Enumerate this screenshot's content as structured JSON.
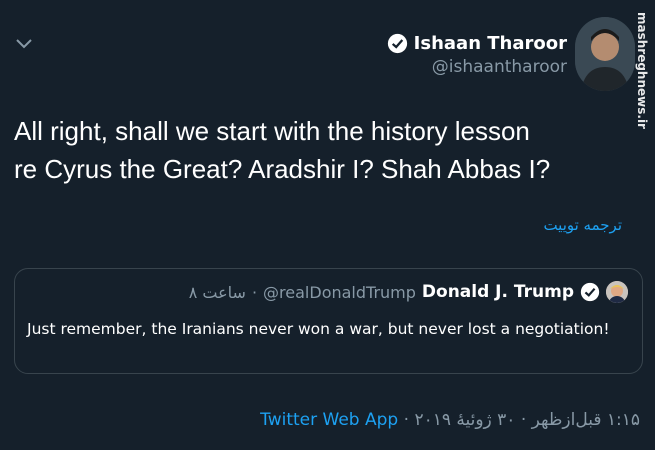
{
  "author": {
    "name": "Ishaan Tharoor",
    "handle": "@ishaantharoor"
  },
  "watermark": "mashreghnews.ir",
  "tweet": {
    "line1": "All right, shall we start with the history lesson",
    "line2": "re Cyrus the Great? Aradshir I? Shah Abbas I?"
  },
  "translate_label": "ترجمه توییت",
  "quoted": {
    "name": "Donald J. Trump",
    "handle": "@realDonaldTrump",
    "separator": "·",
    "time": "۸ ساعت",
    "text": "Just remember, the Iranians never won a war, but never lost a negotiation!"
  },
  "footer": {
    "time": "۱:۱۵ قبل‌ازظهر",
    "date": "۳۰ ژوئیهٔ ۲۰۱۹",
    "separator": "·",
    "app": "Twitter Web App"
  },
  "colors": {
    "background": "#15202b",
    "accent": "#1da1f2",
    "muted": "#8899a6",
    "border": "#38444d"
  }
}
